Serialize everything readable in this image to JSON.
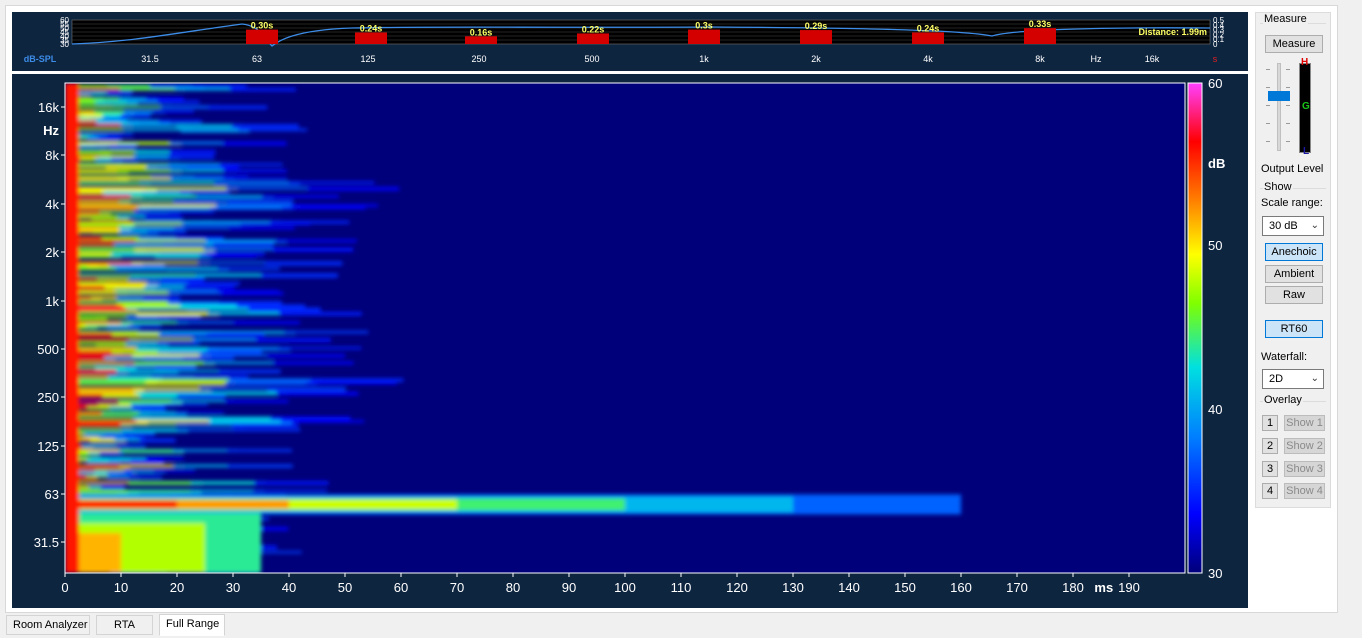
{
  "rt60": {
    "band_labels": [
      "0.30s",
      "0.24s",
      "0.16s",
      "0.22s",
      "0.3s",
      "0.29s",
      "0.24s",
      "0.33s"
    ],
    "band_values": [
      0.3,
      0.24,
      0.16,
      0.22,
      0.3,
      0.29,
      0.24,
      0.33
    ],
    "distance": "Distance: 1.99m",
    "left_ticks": [
      "60",
      "55",
      "50",
      "45",
      "40",
      "35",
      "30"
    ],
    "right_ticks": [
      "0.5",
      "0.4",
      "0.3",
      "0.2",
      "0.1",
      "0"
    ],
    "x_ticks": [
      "dB-SPL",
      "31.5",
      "63",
      "125",
      "250",
      "500",
      "1k",
      "2k",
      "4k",
      "8k",
      "Hz",
      "16k",
      "s"
    ]
  },
  "waterfall": {
    "y_ticks": [
      "16k",
      "Hz",
      "8k",
      "4k",
      "2k",
      "1k",
      "500",
      "250",
      "125",
      "63",
      "31.5"
    ],
    "x_ticks": [
      "0",
      "10",
      "20",
      "30",
      "40",
      "50",
      "60",
      "70",
      "80",
      "90",
      "100",
      "110",
      "120",
      "130",
      "140",
      "150",
      "160",
      "170",
      "180",
      "ms",
      "190"
    ],
    "colorbar": {
      "max": "60",
      "unit": "dB",
      "mid1": "50",
      "mid2": "40",
      "min": "30"
    }
  },
  "panel": {
    "measure_group": "Measure",
    "measure_button": "Measure",
    "meter_labels": {
      "high": "H",
      "good": "G",
      "low": "L"
    },
    "output_level": "Output Level",
    "show_group": "Show",
    "scale_range_label": "Scale range:",
    "scale_range_value": "30 dB",
    "anechoic": "Anechoic",
    "ambient": "Ambient",
    "raw": "Raw",
    "rt60": "RT60",
    "waterfall_label": "Waterfall:",
    "waterfall_value": "2D",
    "overlay_group": "Overlay",
    "overlays": [
      {
        "num": "1",
        "show": "Show 1"
      },
      {
        "num": "2",
        "show": "Show 2"
      },
      {
        "num": "3",
        "show": "Show 3"
      },
      {
        "num": "4",
        "show": "Show 4"
      }
    ]
  },
  "tabs": [
    "Room Analyzer",
    "RTA",
    "Full Range"
  ],
  "colors": {
    "panel_bg": "#0e2540",
    "plot_bg": "#00007a",
    "rt60_bar": "#d40000",
    "rt60_text": "#ffff66",
    "curve": "#3c8ce8"
  }
}
